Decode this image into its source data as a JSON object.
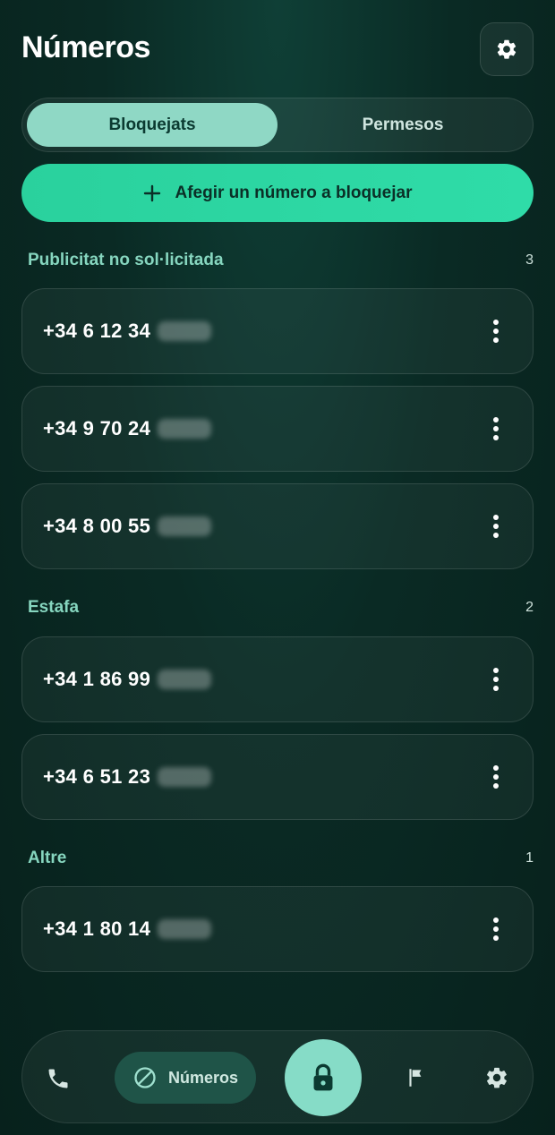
{
  "header": {
    "title": "Números",
    "settings_icon": "gear-icon"
  },
  "tabs": [
    {
      "label": "Bloquejats",
      "active": true
    },
    {
      "label": "Permesos",
      "active": false
    }
  ],
  "add_button": {
    "icon": "plus-icon",
    "label": "Afegir un número a bloquejar"
  },
  "sections": [
    {
      "name": "Publicitat no sol·licitada",
      "count": "3",
      "numbers": [
        "+34 6 12 34",
        "+34 9 70 24",
        "+34 8 00 55"
      ]
    },
    {
      "name": "Estafa",
      "count": "2",
      "numbers": [
        "+34 1 86 99",
        "+34 6 51 23"
      ]
    },
    {
      "name": "Altre",
      "count": "1",
      "numbers": [
        "+34 1 80 14"
      ]
    }
  ],
  "bottom_nav": {
    "items": [
      {
        "icon": "phone-icon"
      },
      {
        "icon": "block-icon",
        "label": "Números",
        "active": true
      },
      {
        "icon": "lock-icon"
      },
      {
        "icon": "flag-icon"
      },
      {
        "icon": "gear-icon"
      }
    ]
  },
  "colors": {
    "accent": "#2fd8a5",
    "tab_active": "#8fd8c5",
    "section_label": "#86d6bf",
    "background": "#0a2a24"
  }
}
